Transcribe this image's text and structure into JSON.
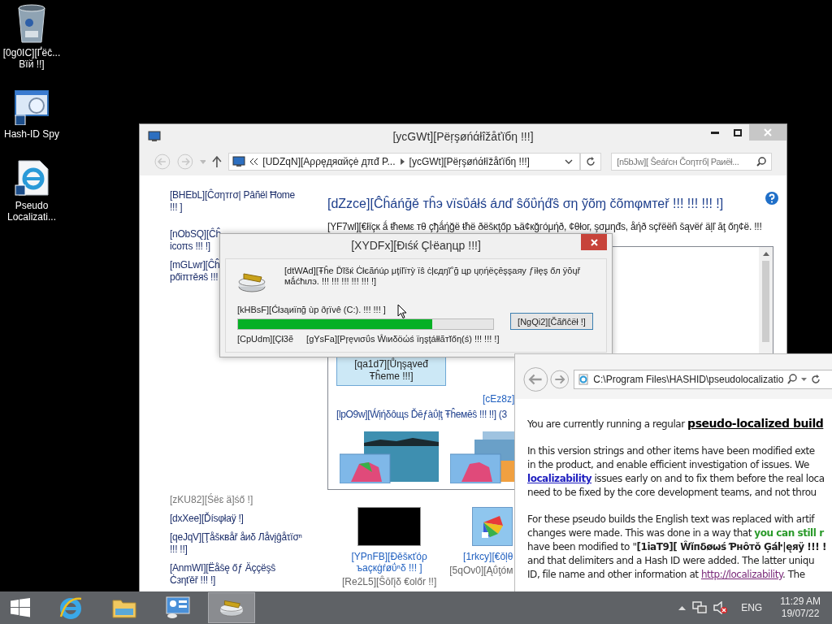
{
  "desktop_icons": [
    {
      "kind": "recycle-bin",
      "lines": [
        "[0g0IC][Ґëĉ...",
        "Вїй !!]"
      ]
    },
    {
      "kind": "spy-tool",
      "lines": [
        "Hash-ID Spy"
      ]
    },
    {
      "kind": "web-document",
      "lines": [
        "Pseudo",
        "Localizati..."
      ]
    }
  ],
  "control_panel": {
    "title": "[ycGWt][Pëŗşøńάłîžåťïбη !!!]",
    "address": {
      "parent": "[UDZqN][Αρρęдяαйçė дπđ Ρ...",
      "current": "[ycGWt][Pëŗşøńάłîžåťïбη !!!]"
    },
    "search": {
      "placeholder": "[n5bJw][ Ŝеáŕсн Čоηтгбļ Раиёł..."
    },
    "sidebar": {
      "items": [
        {
          "lines": [
            "[BHEbL][Ĉσηтгσ| Pâñël Ħome",
            "!!! ]"
          ]
        },
        {
          "lines": [
            "[nObSQ][Ĉĥ",
            "icoπs !!! !]"
          ]
        },
        {
          "lines": [
            "[mGLwr][Ĉĥ",
            "pőiπтěяŝ !!!"
          ]
        }
      ],
      "see_also": {
        "heading": "[zKU82][Śëɛ ä]śő !]",
        "items": [
          {
            "lines": [
              "[dxXee][Ďísφłaÿ !]"
            ]
          },
          {
            "lines": [
              "[qeJqV][Ţåšκвåř åиδ Лåvįĝåτïσⁿ",
              "!!! !!]"
            ]
          },
          {
            "lines": [
              "[AnmWI][Ëåŝę őƒ Äççëşŝ",
              "Ċзηťěř !!! !]"
            ]
          }
        ]
      }
    },
    "heading": "[dZzce][Ĉĥáńğě тĥэ vїsΰáłś áлď ŝőΰήď́ŝ ση ỹõɱ čõmφмтеř !!! !!! !!! !]",
    "description": "[YF7wl][€łïçк ắ ŧћемε тθ çђắήğё ŧћё ðёšĸţőр ъä¢кğгóμήð, ¢θłог, şσμηđs, åήð sçřëëñ šąvëŕ äļľ ăţ őŋ¢ë. !!!",
    "themes": {
      "tiles": [
        {
          "label": "[qa1d7][Ůηşąvеđ Ŧĥеmе !!!]",
          "selected": true
        }
      ],
      "online_link": "[cEz8z]",
      "group": "[lpO9w][Ẃịήδôщs Ďēƒàΰļţ Ŧĥемēŝ !!! !!] (3"
    },
    "bottom_items": [
      {
        "kind": "desktop-background",
        "title": [
          "[YPnFB][Đěšκťóρ",
          "ъaçкġŕøΰⁿδ !!! ]"
        ],
        "subtitle": "[Re2L5][Ŝōľįδ €olőr !!]"
      },
      {
        "kind": "color",
        "title": [
          "[1rkcy][€ǒļθ"
        ],
        "subtitle": "[5qOv0][Ąΰţóм"
      }
    ]
  },
  "dialog": {
    "title": "[XYDFx][Đιśќ Çŀëаηцр !!!]",
    "message": "[dtWAd][Ŧĥе Ďĩšќ Ċłєãńúρ μţíľïтỳ ïŝ ċļєдŋĩ˚ğ цр ųņήëçēşşаяу ƒїłęş őл ÿŏųř мắćћιлэ. !!! !!! !!! !!! !!! !]",
    "status": "[kHBsF][Ćłзąиïпğ ùр ðŗїvê  (C:). !!! !!! ]",
    "level": 0.76,
    "cancel": "[NgQi2][Čãñĉëł !]",
    "details": [
      "[CpUdm][Çł3ẽ",
      "[gYsFa][Pŗęvισΰs Ŵιиδöώś ïŋşţáłłãтĭőη(ś) !!! !!! !]"
    ]
  },
  "browser": {
    "address": "C:\\Program Files\\HASHID\\pseudolocalizatio",
    "paragraphs": [
      [
        [
          {
            "kind": "text",
            "text": "You are currently running a regular "
          },
          {
            "kind": "title",
            "text": "pseudo-localized build"
          }
        ]
      ],
      [
        [
          {
            "kind": "text",
            "text": "In this version strings and other items have been modified exte"
          }
        ],
        [
          {
            "kind": "text",
            "text": "in the product, and enable efficient investigation of issues.  We"
          }
        ],
        [
          {
            "kind": "link",
            "text": "localizability"
          },
          {
            "kind": "text",
            "text": " issues early on and to fix them before the real loca"
          }
        ],
        [
          {
            "kind": "text",
            "text": "need to be fixed by the core development teams, and not throu"
          }
        ]
      ],
      [
        [
          {
            "kind": "text",
            "text": "For these pseudo builds the English text was replaced with artif"
          }
        ],
        [
          {
            "kind": "text",
            "text": "changes were made.  This was done in a way that "
          },
          {
            "kind": "highlight",
            "text": "you can still r"
          }
        ],
        [
          {
            "kind": "text",
            "text": "have been modified to \""
          },
          {
            "kind": "bold",
            "text": "[1iaT9][ Ŵĭпδøωś Ƥнôтŏ Ģáŀ|ęяÿ !!! !"
          }
        ],
        [
          {
            "kind": "text",
            "text": "and that delimiters and a Hash ID were added.  The latter uniqu"
          }
        ],
        [
          {
            "kind": "text",
            "text": "ID, file name and other information at "
          },
          {
            "kind": "url",
            "text": "http://localizability"
          },
          {
            "kind": "text",
            "text": ".  The"
          }
        ]
      ]
    ]
  },
  "taskbar": {
    "apps": [
      {
        "kind": "browser",
        "selected": false
      },
      {
        "kind": "folder",
        "selected": false
      },
      {
        "kind": "control-panel",
        "selected": false
      },
      {
        "kind": "disk-cleanup",
        "selected": true
      }
    ],
    "tray": {
      "muted": true,
      "language": "ENG",
      "time": "11:29 AM",
      "date": "19/07/22"
    }
  }
}
